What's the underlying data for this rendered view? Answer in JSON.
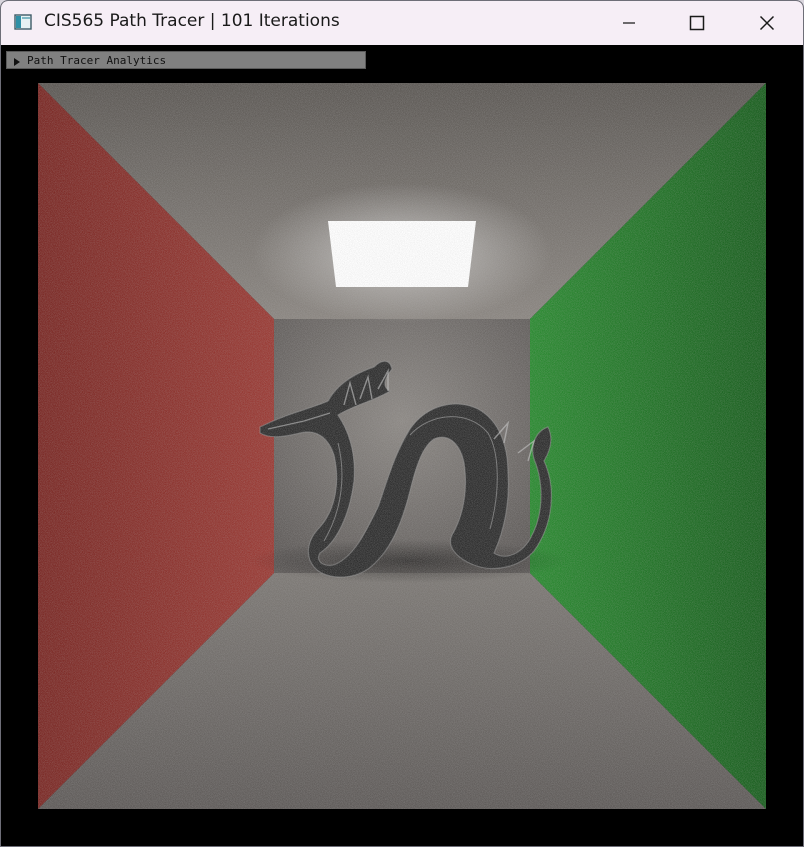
{
  "window": {
    "title": "CIS565 Path Tracer | 101 Iterations",
    "app_icon": "app-window-icon",
    "controls": {
      "minimize_icon": "minimize-icon",
      "maximize_icon": "maximize-icon",
      "close_icon": "close-icon"
    }
  },
  "analytics_panel": {
    "label": "Path Tracer Analytics",
    "collapsed": true,
    "toggle_icon": "triangle-right-icon"
  },
  "render": {
    "scene": "cornell-box-dragon",
    "colors": {
      "left_wall": "#8a2e2a",
      "right_wall": "#1d6e24",
      "back_wall": "#7a7672",
      "light": "#ffffff",
      "dragon": "#3a3a3a"
    }
  }
}
